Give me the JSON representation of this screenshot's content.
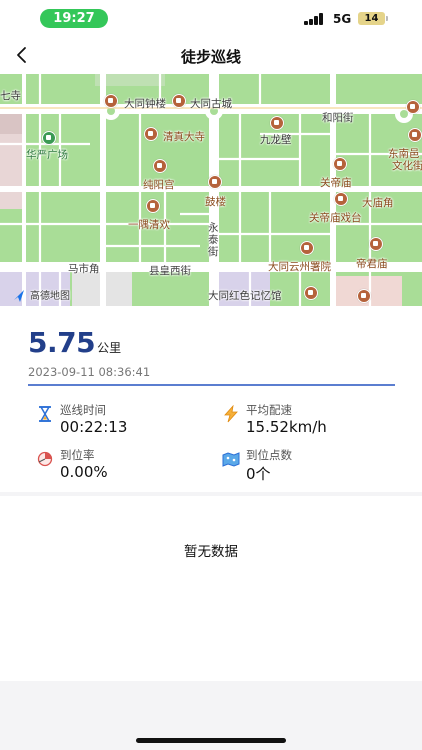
{
  "status_bar": {
    "time": "19:27",
    "network": "5G",
    "battery": "14",
    "time_pill_color": "#34c759"
  },
  "nav": {
    "title": "徒步巡线",
    "back_icon": "chevron-left-icon"
  },
  "map": {
    "provider": "高德地图",
    "labels": {
      "datong_bell_tower": "大同钟楼",
      "datong_old_city": "大同古城",
      "heyang_street": "和阳街",
      "huayan_square": "华严广场",
      "qingzhen_temple": "清真大寺",
      "jiulong_wall": "九龙壁",
      "dongnan_culture": "东南邑",
      "dongnan_culture2": "文化街",
      "chunyang_palace": "纯阳宫",
      "guandi_temple": "关帝庙",
      "drum_tower": "鼓楼",
      "damiao_corner": "大庙角",
      "yiyu_qinghuan": "一隅清欢",
      "guandi_stage": "关帝庙戏台",
      "yongtai_street": "永泰街",
      "mashi_corner": "马市角",
      "xianhuang_west": "县皇西街",
      "yunzhou_office": "大同云州署院",
      "dijun_temple": "帝君庙",
      "red_memory": "大同红色记忆馆",
      "left_edge": "七寺"
    }
  },
  "stats": {
    "distance_value": "5.75",
    "distance_unit": "公里",
    "datetime": "2023-09-11 08:36:41",
    "accent_color": "#223f8a",
    "items": [
      {
        "label": "巡线时间",
        "value": "00:22:13",
        "icon": "hourglass-icon"
      },
      {
        "label": "平均配速",
        "value": "15.52km/h",
        "icon": "lightning-icon"
      },
      {
        "label": "到位率",
        "value": "0.00%",
        "icon": "pie-chart-icon"
      },
      {
        "label": "到位点数",
        "value": "0个",
        "icon": "map-points-icon"
      }
    ]
  },
  "empty_state": {
    "text": "暂无数据"
  }
}
